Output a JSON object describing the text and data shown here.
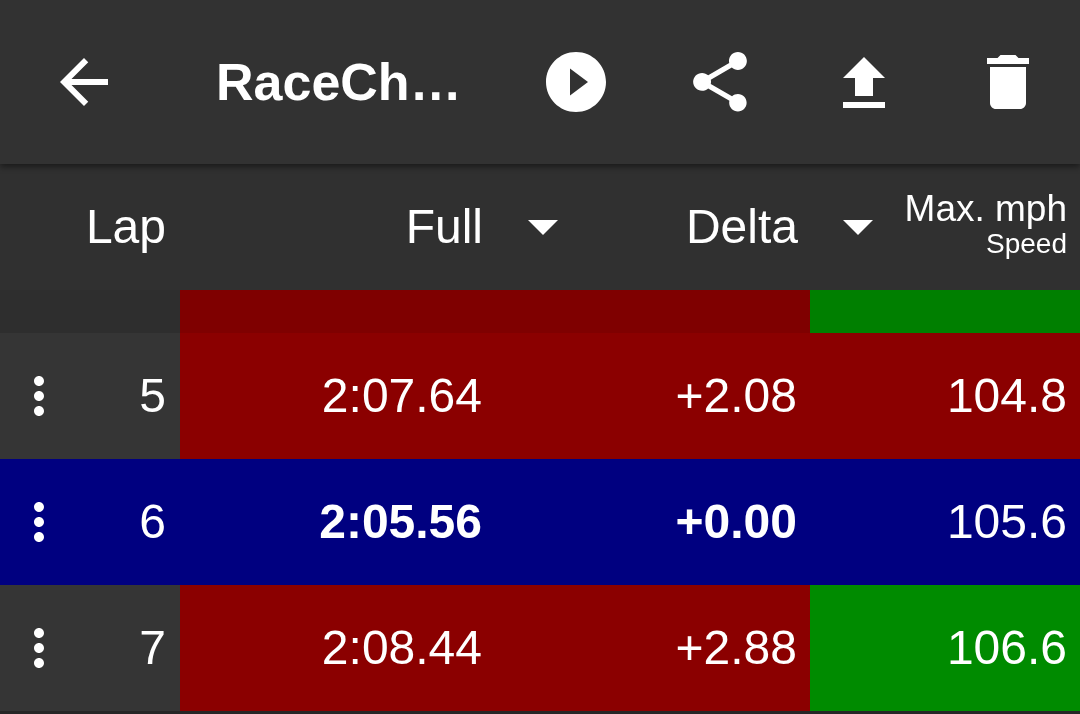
{
  "app_bar": {
    "title": "RaceCh…"
  },
  "table": {
    "columns": [
      {
        "label": "Lap",
        "kind": "plain"
      },
      {
        "label": "Full",
        "kind": "dropdown"
      },
      {
        "label": "Delta",
        "kind": "dropdown"
      },
      {
        "label": "Max. mph",
        "sublabel": "Speed",
        "kind": "two_line"
      }
    ],
    "rows": [
      {
        "kind": "partial",
        "cells": [
          {
            "kind": "lap",
            "color": "#2e2e2e"
          },
          {
            "kind": "value",
            "color": "#7f0000"
          },
          {
            "kind": "value",
            "color": "#7f0000"
          },
          {
            "kind": "value",
            "color": "#007f00"
          }
        ]
      },
      {
        "kind": "lap",
        "cells": [
          {
            "kind": "lap",
            "value": "5",
            "color": "#353535",
            "emphasized": false
          },
          {
            "kind": "value",
            "value": "2:07.64",
            "color": "#8b0000",
            "emphasized": false
          },
          {
            "kind": "value",
            "value": "+2.08",
            "color": "#8b0000",
            "emphasized": false
          },
          {
            "kind": "value",
            "value": "104.8",
            "color": "#8b0000",
            "emphasized": false
          }
        ]
      },
      {
        "kind": "lap",
        "cells": [
          {
            "kind": "lap",
            "value": "6",
            "color": "#000080",
            "emphasized": false
          },
          {
            "kind": "value",
            "value": "2:05.56",
            "color": "#000080",
            "emphasized": true
          },
          {
            "kind": "value",
            "value": "+0.00",
            "color": "#000080",
            "emphasized": true
          },
          {
            "kind": "value",
            "value": "105.6",
            "color": "#000080",
            "emphasized": false
          }
        ]
      },
      {
        "kind": "lap",
        "cells": [
          {
            "kind": "lap",
            "value": "7",
            "color": "#353535",
            "emphasized": false
          },
          {
            "kind": "value",
            "value": "2:08.44",
            "color": "#8b0000",
            "emphasized": false
          },
          {
            "kind": "value",
            "value": "+2.88",
            "color": "#8b0000",
            "emphasized": false
          },
          {
            "kind": "value",
            "value": "106.6",
            "color": "#008b00",
            "emphasized": false
          }
        ]
      }
    ]
  }
}
